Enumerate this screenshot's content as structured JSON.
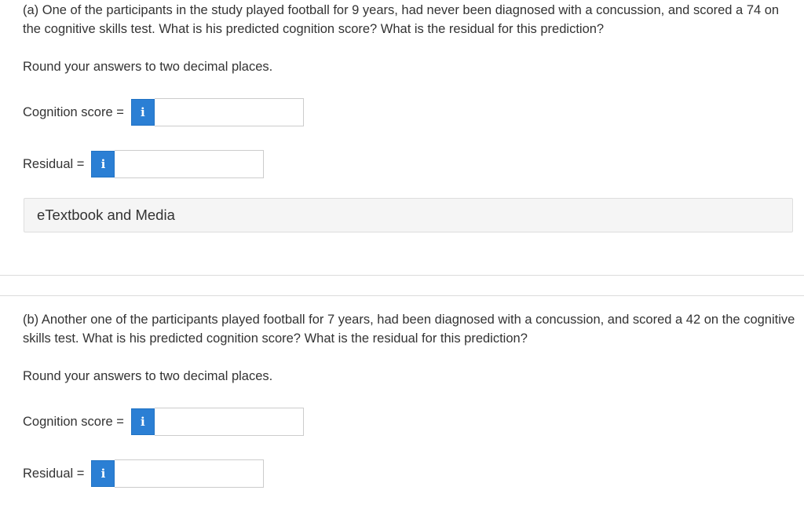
{
  "part_a": {
    "question": "(a) One of the participants in the study played football for 9 years, had never been diagnosed with a concussion, and scored a 74 on the cognitive skills test. What is his predicted cognition score? What is the residual for this prediction?",
    "instruction": "Round your answers to two decimal places.",
    "cognition_label": "Cognition score =",
    "cognition_value": "",
    "residual_label": "Residual =",
    "residual_value": "",
    "info_glyph": "i"
  },
  "etextbook": {
    "label": "eTextbook and Media"
  },
  "part_b": {
    "question": "(b) Another one of the participants played football for 7 years, had been diagnosed with a concussion, and scored a 42 on the cognitive skills test. What is his predicted cognition score? What is the residual for this prediction?",
    "instruction": "Round your answers to two decimal places.",
    "cognition_label": "Cognition score =",
    "cognition_value": "",
    "residual_label": "Residual =",
    "residual_value": "",
    "info_glyph": "i"
  },
  "colors": {
    "accent": "#2b7fd4",
    "panel_bg": "#f5f5f5",
    "text": "#333333"
  }
}
